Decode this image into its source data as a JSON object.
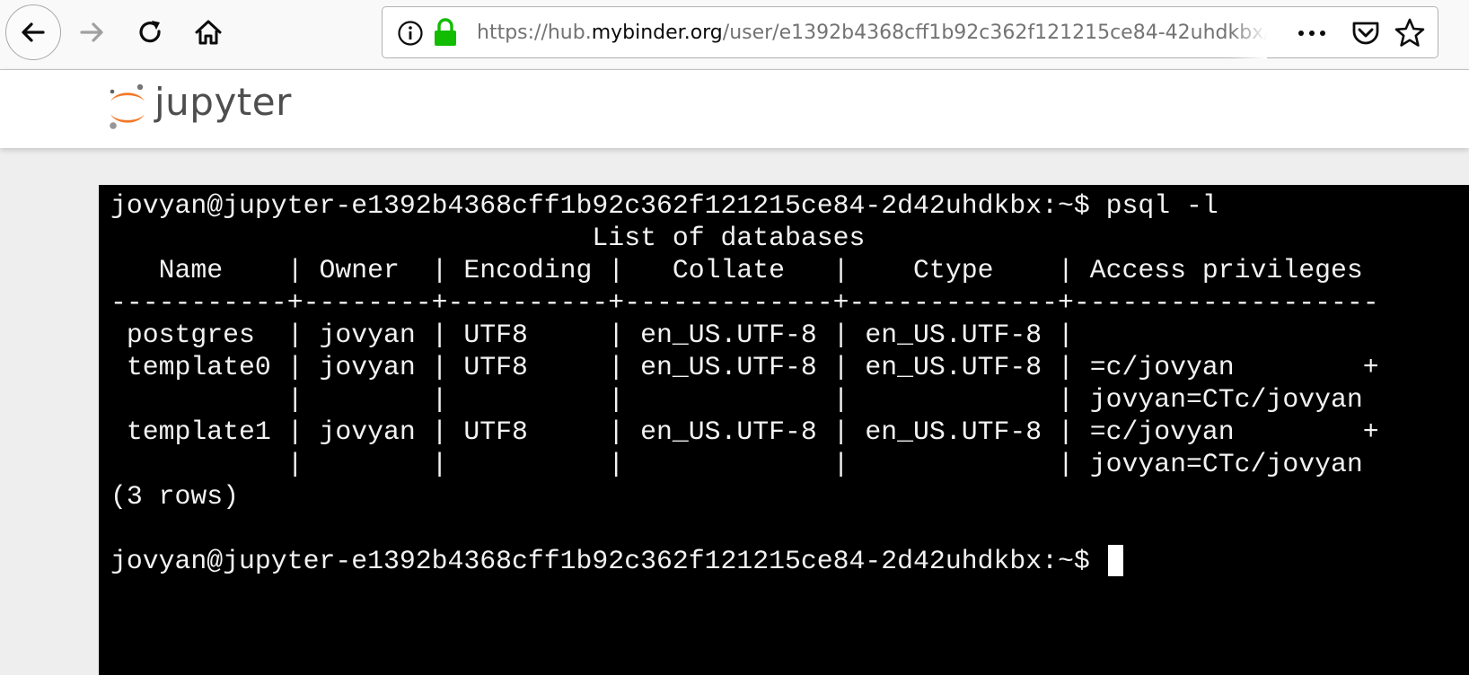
{
  "browser": {
    "url": {
      "prefix": "https://hub.",
      "domain": "mybinder.org",
      "path": "/user/e1392b4368cff1b92c362f121215ce84-42uhdkbx/"
    },
    "icons": {
      "back": "back-arrow-icon",
      "forward": "forward-arrow-icon",
      "reload": "reload-icon",
      "home": "home-icon",
      "info": "info-icon",
      "lock": "lock-icon",
      "more": "more-dots-icon",
      "pocket": "pocket-icon",
      "star": "bookmark-star-icon"
    },
    "colors": {
      "lock": "#12bc00",
      "toolbar_bg": "#f9f9fa"
    }
  },
  "jupyter": {
    "logo_text": "jupyter",
    "colors": {
      "orange": "#f37726",
      "grey": "#616262"
    }
  },
  "terminal": {
    "lines": [
      "jovyan@jupyter-e1392b4368cff1b92c362f121215ce84-2d42uhdkbx:~$ psql -l",
      "                              List of databases",
      "   Name    | Owner  | Encoding |   Collate   |    Ctype    | Access privileges",
      "-----------+--------+----------+-------------+-------------+-------------------",
      " postgres  | jovyan | UTF8     | en_US.UTF-8 | en_US.UTF-8 |",
      " template0 | jovyan | UTF8     | en_US.UTF-8 | en_US.UTF-8 | =c/jovyan        +",
      "           |        |          |             |             | jovyan=CTc/jovyan",
      " template1 | jovyan | UTF8     | en_US.UTF-8 | en_US.UTF-8 | =c/jovyan        +",
      "           |        |          |             |             | jovyan=CTc/jovyan",
      "(3 rows)",
      "",
      "jovyan@jupyter-e1392b4368cff1b92c362f121215ce84-2d42uhdkbx:~$ "
    ],
    "colors": {
      "background": "#000000",
      "foreground": "#f2f2f2",
      "cursor": "#ffffff"
    }
  }
}
